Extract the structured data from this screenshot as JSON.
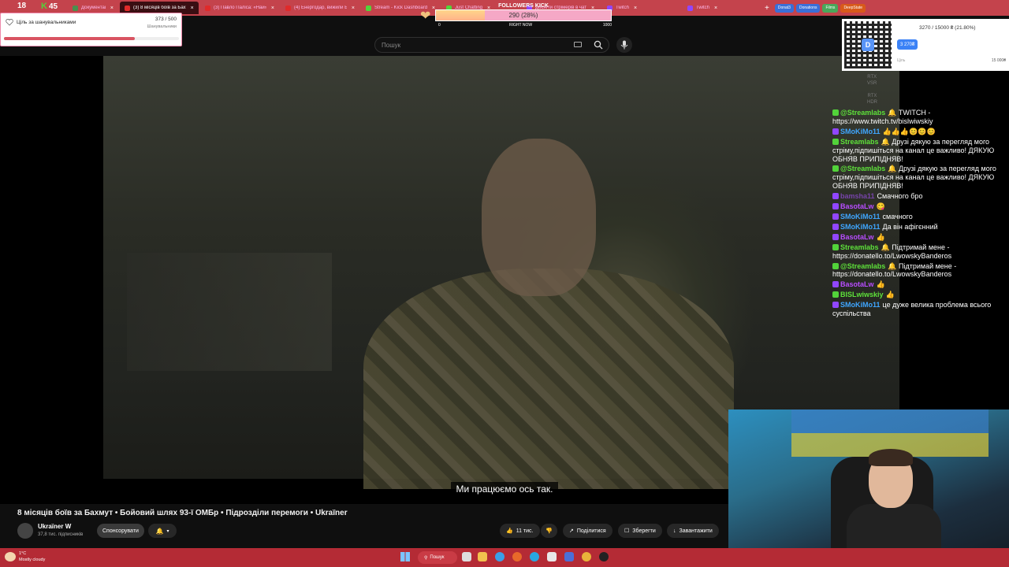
{
  "tabs": [
    {
      "label": "Документація і історія",
      "color": "#4a8f4e"
    },
    {
      "label": "(3) 8 місяців боїв за Бах",
      "color": "#e02a2a",
      "active": true
    },
    {
      "label": "(3) Павло Паліса: «Най»",
      "color": "#e02a2a"
    },
    {
      "label": "(4) Енергодар, вижили Ба",
      "color": "#e02a2a"
    },
    {
      "label": "Stream - Kick Dashboard",
      "color": "#52d33a"
    },
    {
      "label": "Just Chatting",
      "color": "#52d33a"
    },
    {
      "label": "Досягти стрімерів в чат",
      "color": "#9146ff"
    },
    {
      "label": "Twitch",
      "color": "#9146ff"
    },
    {
      "label": "Twitch",
      "color": "#9146ff"
    }
  ],
  "bookmarks": [
    {
      "label": "Donat3",
      "color": "#3a6fd8"
    },
    {
      "label": "Donations",
      "color": "#3a6fd8"
    },
    {
      "label": "Films",
      "color": "#4aa85a"
    },
    {
      "label": "DeepState",
      "color": "#d85a1a"
    }
  ],
  "counters": {
    "left": "18",
    "right": "45"
  },
  "goal": {
    "title": "Ціль за шанувальниками",
    "count": "373 / 500",
    "subtitle": "Шанувальники",
    "progress": 0.746
  },
  "followers": {
    "title": "FOLLOWERS KICK",
    "label": "290 (28%)",
    "progress": 0.28,
    "min": "0",
    "mid": "RIGHT NOW",
    "max": "1000"
  },
  "search": {
    "placeholder": "Пошук"
  },
  "subtitle": "Ми працюємо ось так.",
  "donation": {
    "text": "3270 / 15000 ₴ (21.80%)",
    "pill": "3 270₴",
    "left": "Ціль",
    "right": "15 000₴"
  },
  "rtx": {
    "a": "RTX",
    "b": "VSR",
    "c": "RTX",
    "d": "HDR"
  },
  "chat": [
    {
      "user": "@Streamlabs",
      "cls": "u-green",
      "text": "🔔 TWITCH - https://www.twitch.tv/bislwiwskiy"
    },
    {
      "user": "SMoKiMo11",
      "cls": "u-blue",
      "text": "👍👍👍😊😊😊"
    },
    {
      "user": "Streamlabs",
      "cls": "u-green",
      "text": "🔔 Друзі дякую за перегляд мого стріму,підпишіться на канал це важливо! ДЯКУЮ ОБНЯВ ПРИПІДНЯВ!"
    },
    {
      "user": "@Streamlabs",
      "cls": "u-green",
      "text": "🔔 Друзі дякую за перегляд мого стріму,підпишіться на канал це важливо! ДЯКУЮ ОБНЯВ ПРИПІДНЯВ!"
    },
    {
      "user": "bamsha11",
      "cls": "u-dim",
      "text": "Смачного бро"
    },
    {
      "user": "BasotaLw",
      "cls": "u-purple",
      "text": "😋"
    },
    {
      "user": "SMoKiMo11",
      "cls": "u-blue",
      "text": "смачного"
    },
    {
      "user": "SMoKiMo11",
      "cls": "u-blue",
      "text": "Да він афігєнний"
    },
    {
      "user": "BasotaLw",
      "cls": "u-purple",
      "text": "👍"
    },
    {
      "user": "Streamlabs",
      "cls": "u-green",
      "text": "🔔 Підтримай мене - https://donatello.to/LwowskyBanderos"
    },
    {
      "user": "@Streamlabs",
      "cls": "u-green",
      "text": "🔔 Підтримай мене - https://donatello.to/LwowskyBanderos"
    },
    {
      "user": "BasotaLw",
      "cls": "u-purple",
      "text": "👍"
    },
    {
      "user": "BISLwiwskiy",
      "cls": "u-green",
      "text": "👍"
    },
    {
      "user": "SMoKiMo11",
      "cls": "u-blue",
      "text": "це дуже велика проблема всього суспільства"
    }
  ],
  "video": {
    "title": "8 місяців боїв за Бахмут • Бойовий шлях 93-ї ОМБр • Підрозділи перемоги • Ukraїner",
    "channel": "Ukraїner W",
    "subs": "37,8 тис. підписників",
    "sponsor": "Спонсорувати",
    "likes": "11 тис.",
    "share": "Поділитися",
    "save": "Зберегти",
    "download": "Завантажити"
  },
  "taskbar": {
    "temp": "1°C",
    "weather": "Mostly cloudy",
    "search": "Пошук"
  }
}
